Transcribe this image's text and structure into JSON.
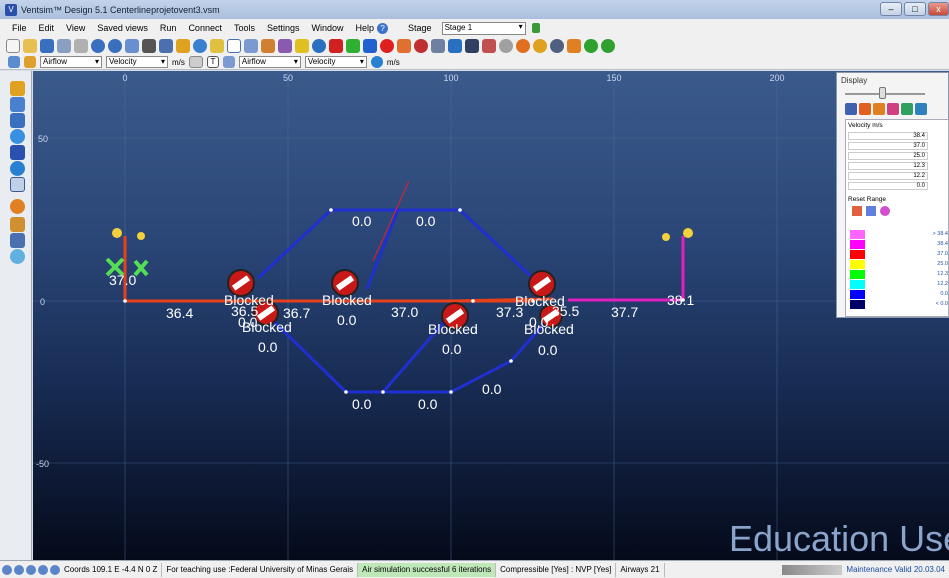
{
  "window": {
    "title": "Ventsim™ Design 5.1   Centerlineprojetovent3.vsm"
  },
  "menu": {
    "items": [
      "File",
      "Edit",
      "View",
      "Saved views",
      "Run",
      "Connect",
      "Tools",
      "Settings",
      "Window",
      "Help"
    ],
    "stage_label": "Stage",
    "stage_value": "Stage 1"
  },
  "toolbar2": {
    "combo1": "Airflow",
    "combo2": "Velocity",
    "unit1": "m/s",
    "combo3": "Airflow",
    "combo4": "Velocity",
    "unit2": "m/s"
  },
  "canvas": {
    "x_ticks": [
      "0",
      "50",
      "100",
      "150",
      "200"
    ],
    "y_ticks": [
      "50",
      "0",
      "-50"
    ],
    "watermark": "Education Use Only",
    "labels": {
      "l_370_top": "37.0",
      "l_364": "36.4",
      "l_365": "36.5",
      "l_367": "36.7",
      "l_0_a": "0.0",
      "l_370_mid": "37.0",
      "l_373": "37.3",
      "l_355": "35.5",
      "l_377": "37.7",
      "l_381": "38.1",
      "l_0_top1": "0.0",
      "l_0_top2": "0.0",
      "l_0_mid": "0.0",
      "l_0_left": "0.0",
      "l_0_c": "0.0",
      "l_0_r": "0.0",
      "l_0_r2": "0.0",
      "l_0_b1": "0.0",
      "l_0_b2": "0.0",
      "l_0_br": "0.0"
    },
    "blocked": [
      "Blocked",
      "Blocked",
      "Blocked",
      "Blocked",
      "Blocked"
    ],
    "colors": {
      "red": "#e8401a",
      "blue": "#1f2fd0",
      "magenta": "#e020c0"
    }
  },
  "display_panel": {
    "title": "Display",
    "label": "Velocity m/s",
    "values": [
      "38.4",
      "37.0",
      "25.0",
      "12.3",
      "12.2",
      "0.0"
    ],
    "reset_label": "Reset Range",
    "legend": [
      {
        "color": "#ff66ff",
        "label": "> 38.4"
      },
      {
        "color": "#ff00ff",
        "label": "38.4"
      },
      {
        "color": "#ff0000",
        "label": "37.0"
      },
      {
        "color": "#ffff00",
        "label": "25.0"
      },
      {
        "color": "#00ff00",
        "label": "12.3"
      },
      {
        "color": "#00ffff",
        "label": "12.2"
      },
      {
        "color": "#0000ff",
        "label": "0.0"
      },
      {
        "color": "#000066",
        "label": "< 0.0"
      }
    ]
  },
  "status": {
    "coords": "Coords 109.1 E   -4.4 N   0 Z",
    "license": "For teaching use :Federal University of Minas Gerais",
    "sim": "Air simulation successful 6 iterations",
    "compressible": "Compressible [Yes] : NVP [Yes]",
    "airways": "Airways 21",
    "maintenance": "Maintenance Valid 20.03.04"
  }
}
